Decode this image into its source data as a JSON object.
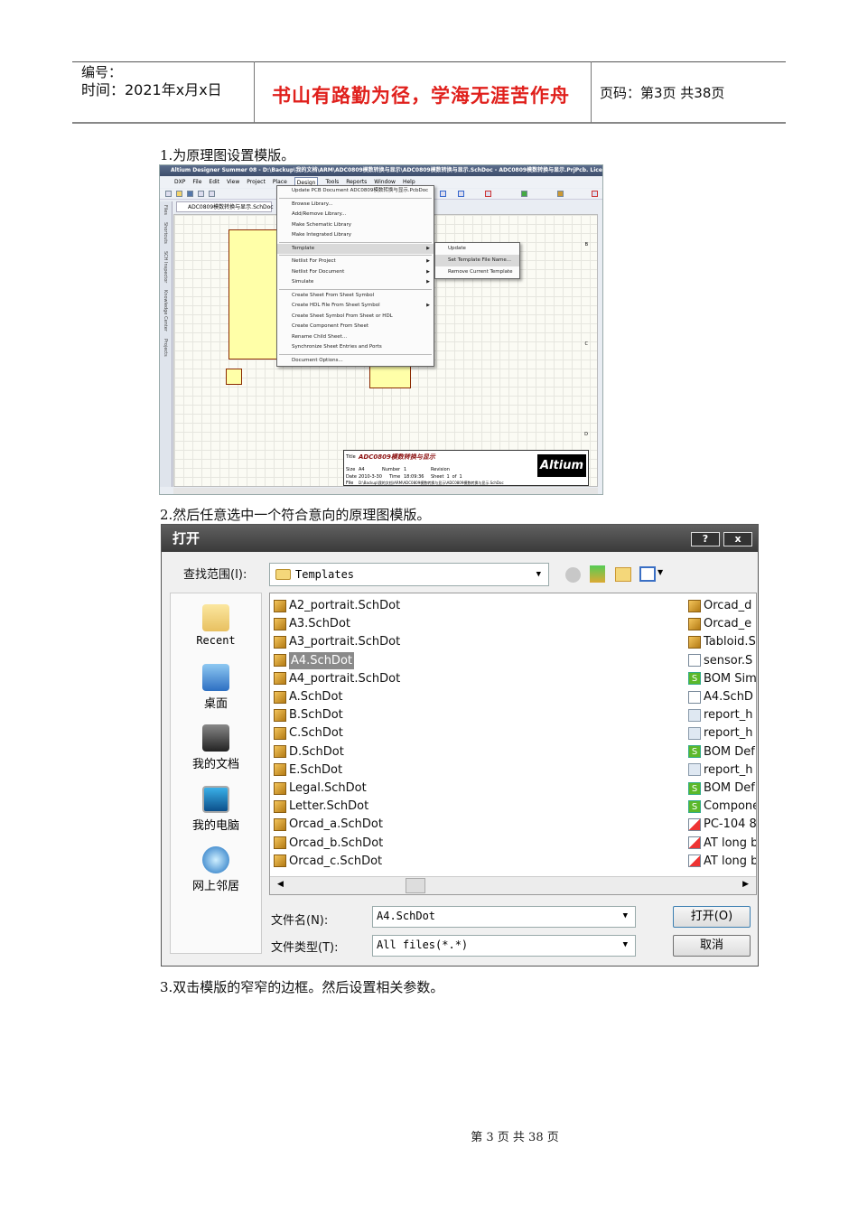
{
  "header": {
    "number_label": "编号：",
    "time_label": "时间：2021年x月x日",
    "motto": "书山有路勤为径，学海无涯苦作舟",
    "page_info": "页码：第3页  共38页"
  },
  "steps": [
    "1.为原理图设置模版。",
    "2.然后任意选中一个符合意向的原理图模版。",
    "3.双击模版的窄窄的边框。然后设置相关参数。"
  ],
  "altium": {
    "title": "Altium Designer Summer 08 - D:\\Backup\\我的文档\\ARM\\ADC0809模数转换与显示\\ADC0809模数转换与显示.SchDoc - ADC0809模数转换与显示.PrjPcb. Licensed to",
    "menus": [
      "DXP",
      "File",
      "Edit",
      "View",
      "Project",
      "Place",
      "Design",
      "Tools",
      "Reports",
      "Window",
      "Help"
    ],
    "doc_tab": "ADC0809模数转换与显示.SchDoc",
    "side_tabs": [
      "Files",
      "Shortcuts",
      "SCH Inspector",
      "Knowledge Center",
      "Projects"
    ],
    "design_menu": [
      "Update PCB Document ADC0809模数转换与显示.PcbDoc",
      "Browse Library...",
      "Add/Remove Library...",
      "Make Schematic Library",
      "Make Integrated Library",
      "Template",
      "Netlist For Project",
      "Netlist For Document",
      "Simulate",
      "Create Sheet From Sheet Symbol",
      "Create HDL File From Sheet Symbol",
      "Create Sheet Symbol From Sheet or HDL",
      "Create Component From Sheet",
      "Rename Child Sheet...",
      "Synchronize Sheet Entries and Ports",
      "Document Options..."
    ],
    "template_submenu": [
      "Update",
      "Set Template File Name...",
      "Remove Current Template"
    ],
    "title_block": {
      "title_label": "Title",
      "title": "ADC0809模数转换与显示",
      "size_label": "Size",
      "size": "A4",
      "number_label": "Number",
      "number": "1",
      "revision_label": "Revision",
      "date_label": "Date",
      "date": "2010-3-30",
      "time_label": "Time",
      "time": "18:09:36",
      "sheet_label": "Sheet",
      "sheet": "1",
      "of": "of",
      "sheets": "1",
      "file_label": "File",
      "file": "D:\\Backup\\我的文档\\ARM\\ADC0809模数转换与显示\\ADC0809模数转换与显示.SchDoc"
    },
    "logo": "Altium",
    "zones": [
      "B",
      "C",
      "D"
    ]
  },
  "dialog": {
    "title": "打开",
    "help": "?",
    "close": "x",
    "look_in_label": "查找范围(I):",
    "look_in": "Templates",
    "places": [
      "Recent",
      "桌面",
      "我的文档",
      "我的电脑",
      "网上邻居"
    ],
    "files_left": [
      "A2_portrait.SchDot",
      "A3.SchDot",
      "A3_portrait.SchDot",
      "A4.SchDot",
      "A4_portrait.SchDot",
      "A.SchDot",
      "B.SchDot",
      "C.SchDot",
      "D.SchDot",
      "E.SchDot",
      "Legal.SchDot",
      "Letter.SchDot",
      "Orcad_a.SchDot",
      "Orcad_b.SchDot",
      "Orcad_c.SchDot"
    ],
    "selected_file": "A4.SchDot",
    "files_right": [
      {
        "name": "Orcad_d",
        "icon": "tpl"
      },
      {
        "name": "Orcad_e",
        "icon": "tpl"
      },
      {
        "name": "Tabloid.S",
        "icon": "tpl"
      },
      {
        "name": "sensor.S",
        "icon": "doc"
      },
      {
        "name": "BOM Sim",
        "icon": "s"
      },
      {
        "name": "A4.SchD",
        "icon": "doc"
      },
      {
        "name": "report_h",
        "icon": "rep"
      },
      {
        "name": "report_h",
        "icon": "rep"
      },
      {
        "name": "BOM Def",
        "icon": "s"
      },
      {
        "name": "report_h",
        "icon": "rep"
      },
      {
        "name": "BOM Def",
        "icon": "s"
      },
      {
        "name": "Compone",
        "icon": "s"
      },
      {
        "name": "PC-104 8",
        "icon": "pcb"
      },
      {
        "name": "AT long b",
        "icon": "pcb"
      },
      {
        "name": "AT long b",
        "icon": "pcb"
      }
    ],
    "filename_label": "文件名(N):",
    "filename": "A4.SchDot",
    "filetype_label": "文件类型(T):",
    "filetype": "All files(*.*)",
    "open_button": "打开(O)",
    "cancel_button": "取消"
  },
  "footer": "第 3 页 共 38 页"
}
